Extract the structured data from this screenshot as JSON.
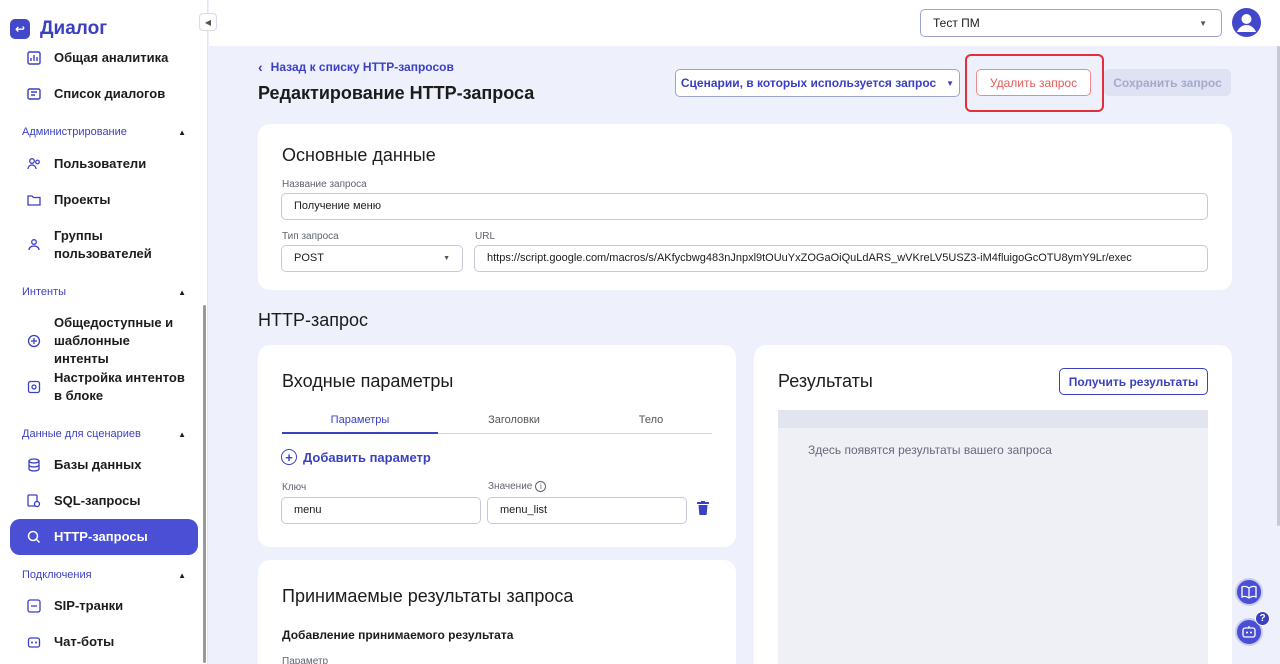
{
  "app": {
    "name": "Диалог",
    "logo_glyph": "↩"
  },
  "sidebar": {
    "items_top": [
      {
        "label": "Общая аналитика"
      },
      {
        "label": "Список диалогов"
      }
    ],
    "sections": [
      {
        "title": "Администрирование"
      },
      {
        "title": "Интенты"
      },
      {
        "title": "Данные для сценариев"
      },
      {
        "title": "Подключения"
      }
    ],
    "admin_items": [
      {
        "label": "Пользователи"
      },
      {
        "label": "Проекты"
      },
      {
        "label": "Группы пользователей"
      }
    ],
    "intent_items": [
      {
        "label": "Общедоступные и шаблонные интенты"
      },
      {
        "label": "Настройка интентов в блоке"
      }
    ],
    "data_items": [
      {
        "label": "Базы данных"
      },
      {
        "label": "SQL-запросы"
      },
      {
        "label": "HTTP-запросы"
      }
    ],
    "conn_items": [
      {
        "label": "SIP-транки"
      },
      {
        "label": "Чат-боты"
      }
    ],
    "active_item": "HTTP-запросы"
  },
  "topbar": {
    "project": "Тест ПМ"
  },
  "header": {
    "back_link": "Назад к списку HTTP-запросов",
    "title": "Редактирование HTTP-запроса",
    "scenarios_button": "Сценарии, в которых используется запрос",
    "delete_button": "Удалить запрос",
    "save_button": "Сохранить запрос"
  },
  "basic": {
    "title": "Основные данные",
    "name_label": "Название запроса",
    "name_value": "Получение меню",
    "type_label": "Тип запроса",
    "type_value": "POST",
    "url_label": "URL",
    "url_value": "https://script.google.com/macros/s/AKfycbwg483nJnpxl9tOUuYxZOGaOiQuLdARS_wVKreLV5USZ3-iM4fluigoGcOTU8ymY9Lr/exec"
  },
  "http": {
    "heading": "HTTP-запрос",
    "inputs": {
      "title": "Входные параметры",
      "tabs": [
        {
          "label": "Параметры"
        },
        {
          "label": "Заголовки"
        },
        {
          "label": "Тело"
        }
      ],
      "add_param": "Добавить параметр",
      "key_label": "Ключ",
      "value_label": "Значение",
      "key_value": "menu",
      "value_value": "menu_list"
    },
    "results": {
      "title": "Результаты",
      "button": "Получить результаты",
      "placeholder": "Здесь появятся результаты вашего запроса"
    },
    "accepted": {
      "title": "Принимаемые результаты запроса",
      "subheading": "Добавление принимаемого результата",
      "param_label": "Параметр"
    }
  },
  "colors": {
    "accent": "#4a4fd6",
    "danger": "#e0303c",
    "bg": "#eef0fb"
  }
}
